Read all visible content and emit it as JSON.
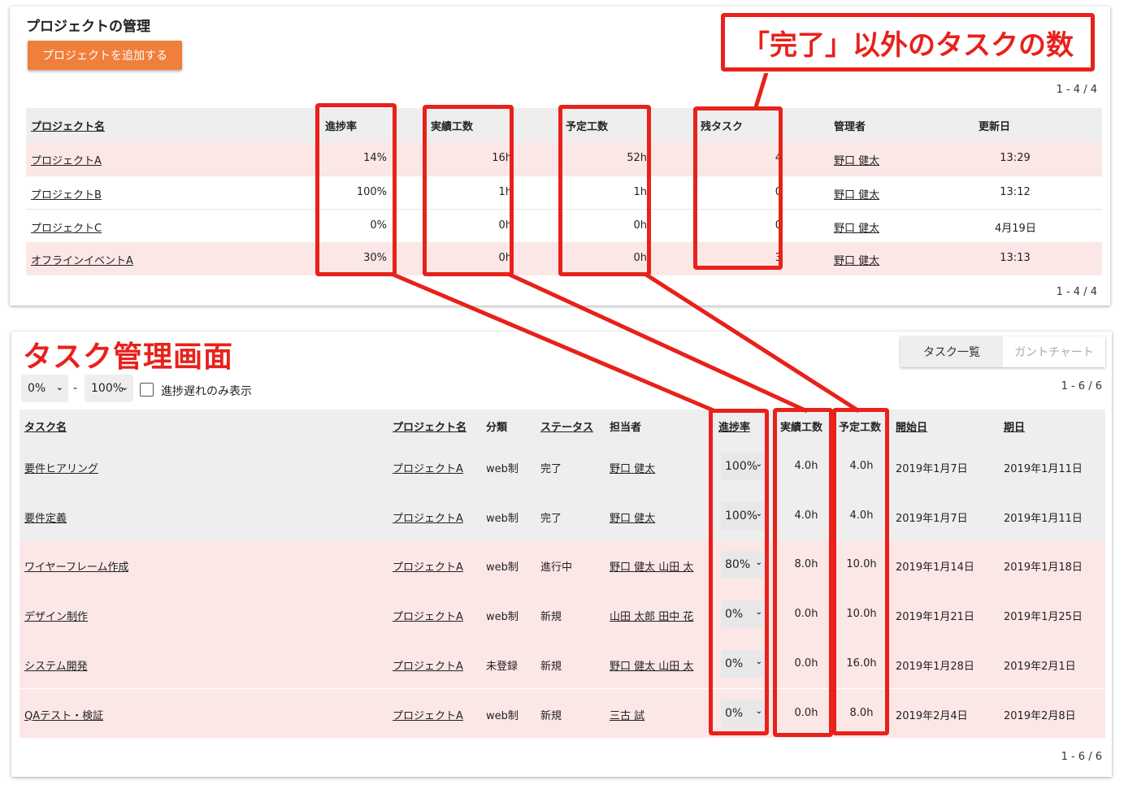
{
  "project_panel": {
    "title": "プロジェクトの管理",
    "add_button": "プロジェクトを追加する",
    "pager_top": "1 - 4 / 4",
    "pager_bottom": "1 - 4 / 4",
    "headers": [
      "プロジェクト名",
      "進捗率",
      "実績工数",
      "予定工数",
      "残タスク",
      "管理者",
      "更新日"
    ],
    "rows": [
      {
        "name": "プロジェクトA",
        "progress": "14%",
        "actual": "16h",
        "planned": "52h",
        "remaining": "4",
        "manager": "野口 健太",
        "updated": "13:29"
      },
      {
        "name": "プロジェクトB",
        "progress": "100%",
        "actual": "1h",
        "planned": "1h",
        "remaining": "0",
        "manager": "野口 健太",
        "updated": "13:12"
      },
      {
        "name": "プロジェクトC",
        "progress": "0%",
        "actual": "0h",
        "planned": "0h",
        "remaining": "0",
        "manager": "野口 健太",
        "updated": "4月19日"
      },
      {
        "name": "オフラインイベントA",
        "progress": "30%",
        "actual": "0h",
        "planned": "0h",
        "remaining": "3",
        "manager": "野口 健太",
        "updated": "13:13"
      }
    ]
  },
  "annotations": {
    "callout": "「完了」以外のタスクの数",
    "task_screen_label": "タスク管理画面",
    "accent_color": "#e8211a"
  },
  "task_panel": {
    "tabs": [
      "タスク一覧",
      "ガントチャート"
    ],
    "filter_from": "0%",
    "filter_sep": "-",
    "filter_to": "100%",
    "delayed_only_label": "進捗遅れのみ表示",
    "pager_top": "1 - 6 / 6",
    "pager_bottom": "1 - 6 / 6",
    "headers": [
      "タスク名",
      "プロジェクト名",
      "分類",
      "ステータス",
      "担当者",
      "進捗率",
      "実績工数",
      "予定工数",
      "開始日",
      "期日"
    ],
    "rows": [
      {
        "task": "要件ヒアリング",
        "project": "プロジェクトA",
        "category": "web制",
        "status": "完了",
        "assignee": "野口 健太",
        "progress": "100%",
        "actual": "4.0h",
        "planned": "4.0h",
        "start": "2019年1月7日",
        "due": "2019年1月11日"
      },
      {
        "task": "要件定義",
        "project": "プロジェクトA",
        "category": "web制",
        "status": "完了",
        "assignee": "野口 健太",
        "progress": "100%",
        "actual": "4.0h",
        "planned": "4.0h",
        "start": "2019年1月7日",
        "due": "2019年1月11日"
      },
      {
        "task": "ワイヤーフレーム作成",
        "project": "プロジェクトA",
        "category": "web制",
        "status": "進行中",
        "assignee": "野口 健太 山田 太",
        "progress": "80%",
        "actual": "8.0h",
        "planned": "10.0h",
        "start": "2019年1月14日",
        "due": "2019年1月18日"
      },
      {
        "task": "デザイン制作",
        "project": "プロジェクトA",
        "category": "web制",
        "status": "新規",
        "assignee": "山田 太郎 田中 花",
        "progress": "0%",
        "actual": "0.0h",
        "planned": "10.0h",
        "start": "2019年1月21日",
        "due": "2019年1月25日"
      },
      {
        "task": "システム開発",
        "project": "プロジェクトA",
        "category": "未登録",
        "status": "新規",
        "assignee": "野口 健太 山田 太",
        "progress": "0%",
        "actual": "0.0h",
        "planned": "16.0h",
        "start": "2019年1月28日",
        "due": "2019年2月1日"
      },
      {
        "task": "QAテスト・検証",
        "project": "プロジェクトA",
        "category": "web制",
        "status": "新規",
        "assignee": "三古 試",
        "progress": "0%",
        "actual": "0.0h",
        "planned": "8.0h",
        "start": "2019年2月4日",
        "due": "2019年2月8日"
      }
    ]
  }
}
